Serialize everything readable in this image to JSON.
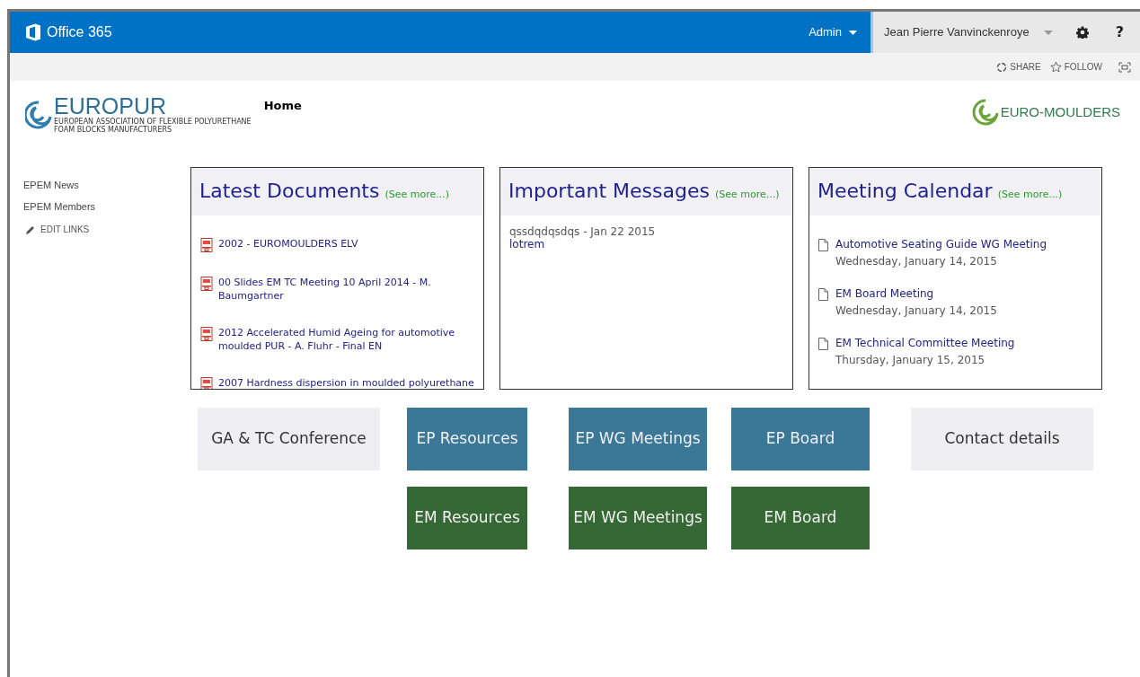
{
  "suite_bar": {
    "brand": "Office 365",
    "admin": "Admin",
    "user": "Jean Pierre Vanvinckenroye",
    "help": "?"
  },
  "ribbon": {
    "share": "SHARE",
    "follow": "FOLLOW"
  },
  "header": {
    "logo_left": {
      "name": "EUROPUR",
      "subtitle_1": "EUROPEAN ASSOCIATION OF FLEXIBLE POLYURETHANE",
      "subtitle_2": "FOAM BLOCKS MANUFACTURERS"
    },
    "page_title": "Home",
    "logo_right": {
      "name": "EURO-MOULDERS"
    }
  },
  "sidebar": {
    "items": [
      {
        "label": "EPEM News"
      },
      {
        "label": "EPEM Members"
      }
    ],
    "edit_links": "EDIT LINKS"
  },
  "panels": [
    {
      "kind": "documents",
      "title": "Latest Documents",
      "see_more": "(See more...)",
      "items": [
        {
          "title": "2002 - EUROMOULDERS ELV"
        },
        {
          "title": "00 Slides EM TC Meeting 10 April 2014 - M. Baumgartner"
        },
        {
          "title": "2012 Accelerated Humid Ageing for automotive moulded PUR - A. Fluhr - Final EN"
        },
        {
          "title": "2007 Hardness dispersion in moulded polyurethane"
        }
      ]
    },
    {
      "kind": "messages",
      "title": "Important Messages",
      "see_more": "(See more...)",
      "items": [
        {
          "meta": "qssdqdqsdqs - Jan 22 2015",
          "title": "lotrem"
        }
      ]
    },
    {
      "kind": "calendar",
      "title": "Meeting Calendar",
      "see_more": "(See more...)",
      "items": [
        {
          "title": "Automotive Seating Guide WG Meeting",
          "date": "Wednesday, January 14, 2015"
        },
        {
          "title": "EM Board Meeting",
          "date": "Wednesday, January 14, 2015"
        },
        {
          "title": "EM Technical Committee Meeting",
          "date": "Thursday, January 15, 2015"
        }
      ]
    }
  ],
  "tiles": [
    [
      {
        "label": "GA & TC Conference",
        "color": "#efeff3"
      },
      {
        "label": "EP Resources",
        "color": "#3b7797"
      },
      {
        "label": "EP WG Meetings",
        "color": "#3b7797"
      },
      {
        "label": "EP Board",
        "color": "#3b7797"
      },
      {
        "label": "Contact details",
        "color": "#efeff3"
      }
    ],
    [
      {
        "label": "EM Resources",
        "color": "#356834"
      },
      {
        "label": "EM WG Meetings",
        "color": "#356834"
      },
      {
        "label": "EM Board",
        "color": "#356834"
      }
    ]
  ]
}
